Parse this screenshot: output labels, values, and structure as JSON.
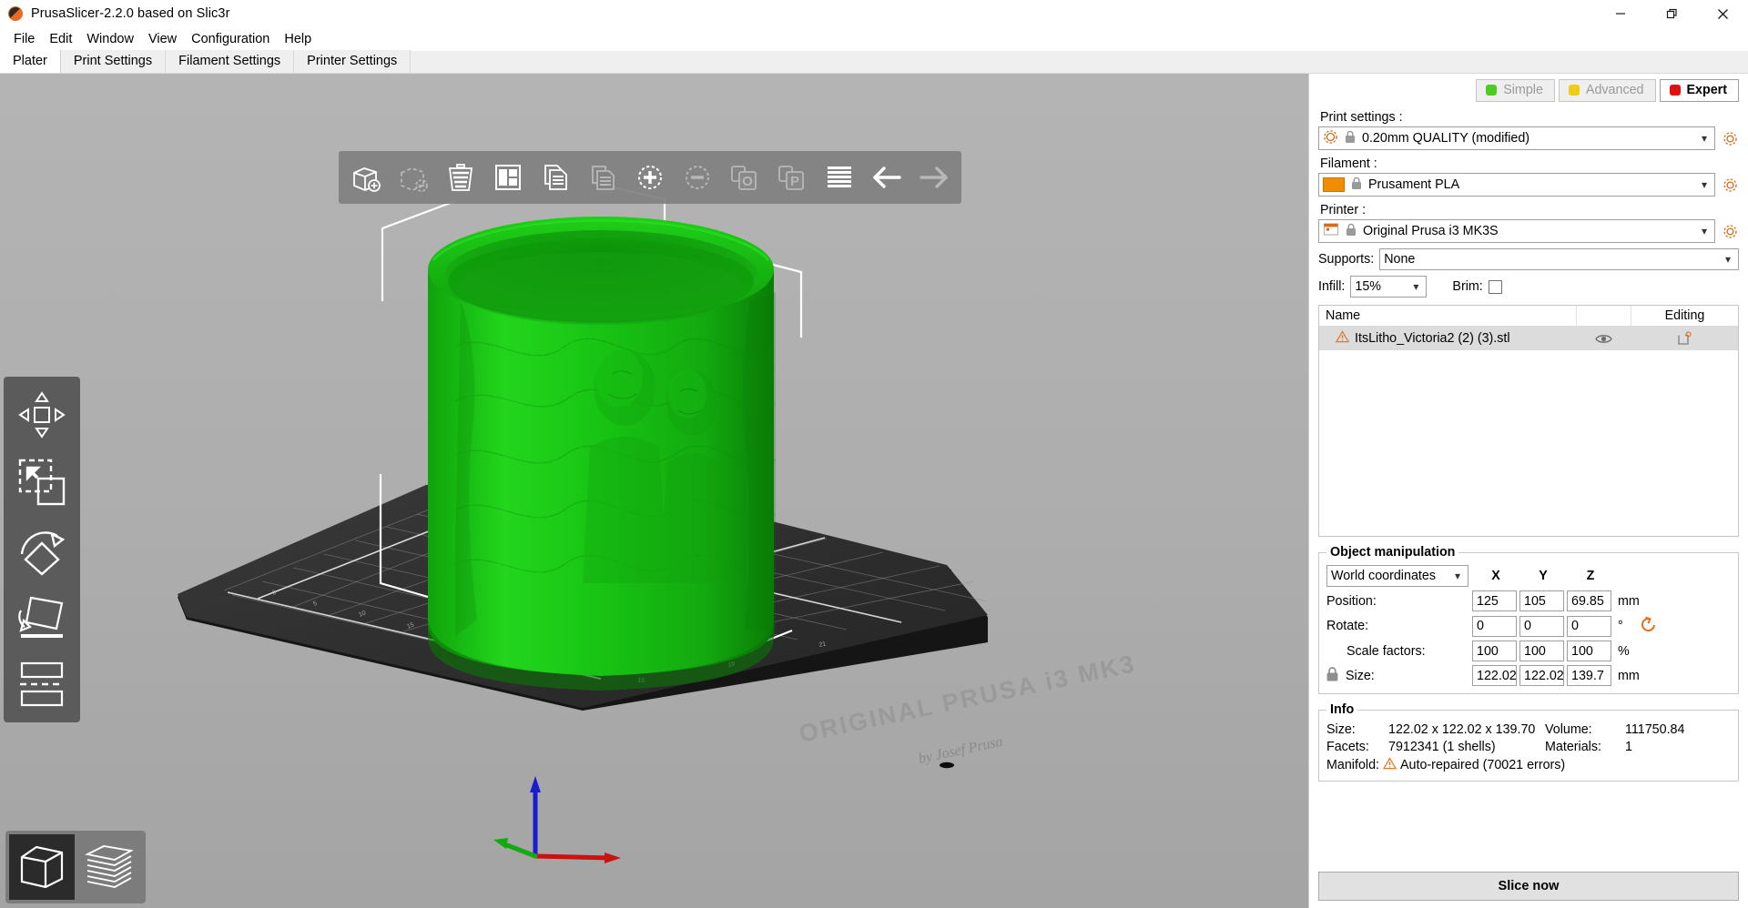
{
  "window": {
    "title": "PrusaSlicer-2.2.0 based on Slic3r",
    "logo_icon": "prusa-logo-icon",
    "minimize_label": "—",
    "maximize_label": "❐",
    "close_label": "✕"
  },
  "menubar": {
    "items": [
      {
        "label": "File"
      },
      {
        "label": "Edit"
      },
      {
        "label": "Window"
      },
      {
        "label": "View"
      },
      {
        "label": "Configuration"
      },
      {
        "label": "Help"
      }
    ]
  },
  "tabs": [
    {
      "label": "Plater",
      "active": true
    },
    {
      "label": "Print Settings",
      "active": false
    },
    {
      "label": "Filament Settings",
      "active": false
    },
    {
      "label": "Printer Settings",
      "active": false
    }
  ],
  "viewport": {
    "background_color": "#b0b0b0",
    "model_color": "#18c014",
    "bed_color": "#262626",
    "bed_text_main": "ORIGINAL PRUSA i3 MK3",
    "bed_text_sub": "by Josef Prusa",
    "axis_colors": {
      "x": "#cc1111",
      "y": "#11aa11",
      "z": "#1111cc"
    },
    "toolbar": [
      {
        "name": "add-icon",
        "enabled": true
      },
      {
        "name": "delete-selected-icon",
        "enabled": false
      },
      {
        "name": "delete-all-icon",
        "enabled": true
      },
      {
        "name": "arrange-icon",
        "enabled": true
      },
      {
        "name": "copy-icon",
        "enabled": true
      },
      {
        "name": "paste-icon",
        "enabled": false
      },
      {
        "name": "add-instance-icon",
        "enabled": true
      },
      {
        "name": "remove-instance-icon",
        "enabled": false
      },
      {
        "name": "split-to-objects-icon",
        "enabled": false
      },
      {
        "name": "split-to-parts-icon",
        "enabled": false
      },
      {
        "name": "layers-editing-icon",
        "enabled": true
      },
      {
        "name": "undo-icon",
        "enabled": true
      },
      {
        "name": "redo-icon",
        "enabled": false
      }
    ],
    "gizmos": [
      {
        "name": "move-gizmo-icon"
      },
      {
        "name": "scale-gizmo-icon"
      },
      {
        "name": "rotate-gizmo-icon"
      },
      {
        "name": "place-on-face-gizmo-icon"
      },
      {
        "name": "cut-gizmo-icon"
      }
    ],
    "view_modes": [
      {
        "name": "editor-view-button",
        "active": true
      },
      {
        "name": "preview-view-button",
        "active": false
      }
    ]
  },
  "sidebar": {
    "modes": [
      {
        "label": "Simple",
        "color": "#4ccc22",
        "active": false
      },
      {
        "label": "Advanced",
        "color": "#f0cc15",
        "active": false
      },
      {
        "label": "Expert",
        "color": "#dd1111",
        "active": true
      }
    ],
    "presets": {
      "print_settings_label": "Print settings :",
      "print_settings_value": "0.20mm QUALITY (modified)",
      "filament_label": "Filament :",
      "filament_value": "Prusament PLA",
      "filament_color": "#f28c00",
      "printer_label": "Printer :",
      "printer_value": "Original Prusa i3 MK3S"
    },
    "supports": {
      "label": "Supports:",
      "value": "None"
    },
    "infill": {
      "label": "Infill:",
      "value": "15%"
    },
    "brim": {
      "label": "Brim:",
      "checked": false
    },
    "object_list": {
      "columns": [
        "Name",
        "",
        "Editing"
      ],
      "rows": [
        {
          "name": "ItsLitho_Victoria2 (2) (3).stl",
          "warning_icon": "warning-triangle-icon",
          "eye_icon": "eye-icon",
          "edit_icon": "layer-settings-icon"
        }
      ]
    },
    "object_manipulation": {
      "title": "Object manipulation",
      "coordinate_space": "World coordinates",
      "axes": [
        "X",
        "Y",
        "Z"
      ],
      "rows": [
        {
          "label": "Position:",
          "values": [
            "125",
            "105",
            "69.85"
          ],
          "unit": "mm"
        },
        {
          "label": "Rotate:",
          "values": [
            "0",
            "0",
            "0"
          ],
          "unit": "°"
        },
        {
          "label": "Scale factors:",
          "values": [
            "100",
            "100",
            "100"
          ],
          "unit": "%"
        },
        {
          "label": "Size:",
          "values": [
            "122.02",
            "122.02",
            "139.7"
          ],
          "unit": "mm"
        }
      ],
      "reset_icon": "reset-rotation-icon",
      "lock_icon": "uniform-scale-lock-icon"
    },
    "info": {
      "title": "Info",
      "size_label": "Size:",
      "size_value": "122.02 x 122.02 x 139.70",
      "volume_label": "Volume:",
      "volume_value": "111750.84",
      "facets_label": "Facets:",
      "facets_value": "7912341 (1 shells)",
      "materials_label": "Materials:",
      "materials_value": "1",
      "manifold_label": "Manifold:",
      "manifold_value": "Auto-repaired (70021 errors)",
      "manifold_icon": "warning-triangle-icon"
    },
    "slice_button": "Slice now"
  }
}
